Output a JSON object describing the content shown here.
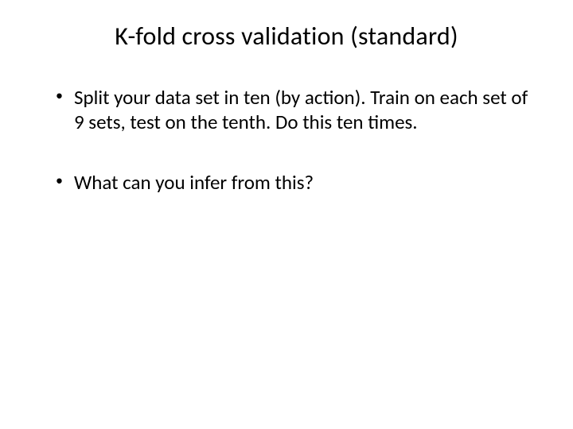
{
  "slide": {
    "title": "K-fold cross validation (standard)",
    "bullets": [
      {
        "marker": "•",
        "text": "Split your data set in ten (by action). Train on each set of 9 sets, test on the tenth. Do this ten times."
      },
      {
        "marker": "•",
        "text": "What can you infer from this?"
      }
    ]
  }
}
